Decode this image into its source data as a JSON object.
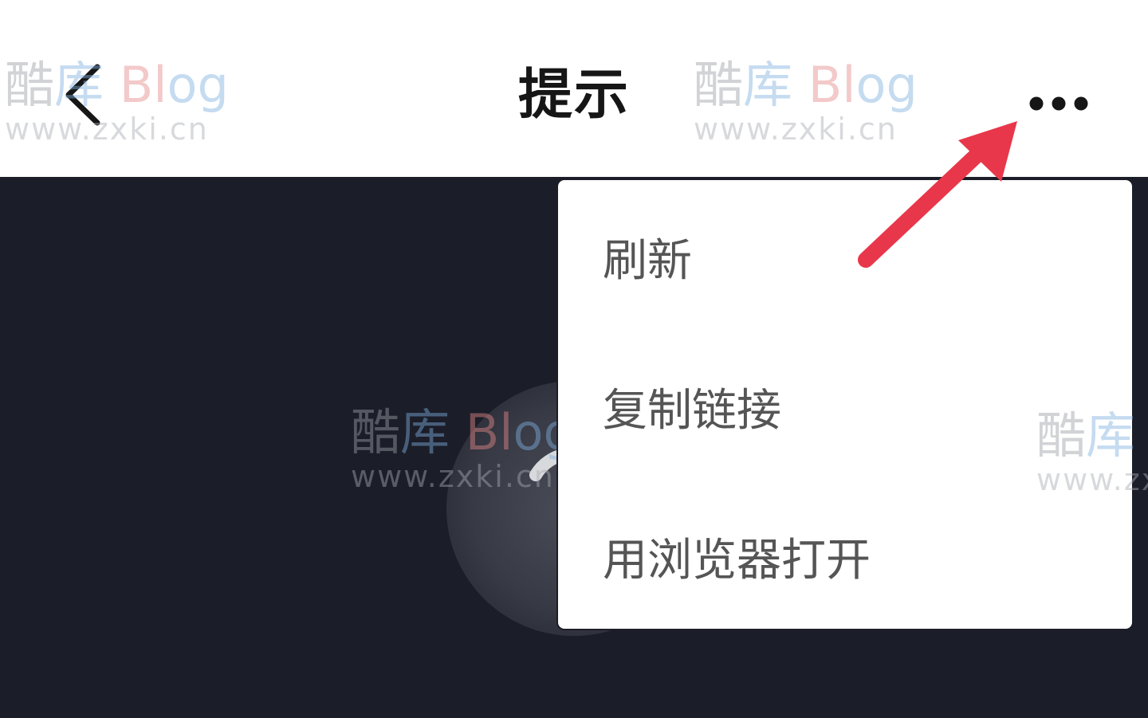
{
  "header": {
    "title": "提示",
    "back_icon": "chevron-left-icon",
    "more_icon": "more-horizontal-icon"
  },
  "menu": {
    "items": [
      {
        "label": "刷新"
      },
      {
        "label": "复制链接"
      },
      {
        "label": "用浏览器打开"
      }
    ]
  },
  "watermark": {
    "logo_part1": "酷",
    "logo_part2": "库",
    "logo_part3": "Bl",
    "logo_part4": "og",
    "url": "www.zxki.cn"
  },
  "colors": {
    "header_bg": "#ffffff",
    "content_bg": "#1b1d28",
    "title": "#161616",
    "menu_text": "#555555",
    "annotation_arrow": "#e8374a"
  }
}
